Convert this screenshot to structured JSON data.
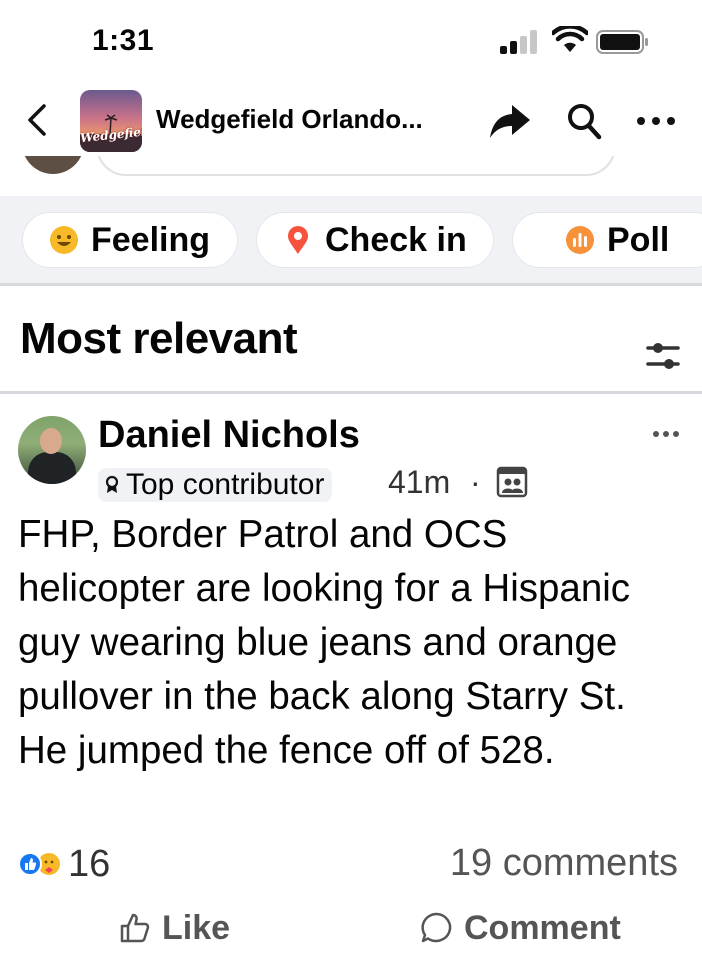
{
  "status_bar": {
    "time": "1:31"
  },
  "header": {
    "group_name": "Wedgefield Orlando...",
    "group_avatar_text": "Wedgefiel"
  },
  "composer_chips": [
    {
      "label": "Feeling",
      "icon": "feeling-icon",
      "color": "#f7b928"
    },
    {
      "label": "Check in",
      "icon": "location-pin-icon",
      "color": "#f5533d"
    },
    {
      "label": "Poll",
      "icon": "poll-icon",
      "color": "#f7923b"
    }
  ],
  "sort": {
    "title": "Most relevant",
    "icon": "filter-sliders-icon"
  },
  "post": {
    "author": "Daniel Nichols",
    "badge": "Top contributor",
    "time": "41m",
    "separator": "·",
    "audience_icon": "group-audience-icon",
    "text": "FHP, Border Patrol and OCS helicopter are looking for a Hispanic guy wearing blue jeans and orange pullover in the back along Starry St. He jumped the fence off of 528.",
    "reaction_count": "16",
    "comments": "19 comments",
    "actions": {
      "like": "Like",
      "comment": "Comment"
    }
  },
  "colors": {
    "accent": "#1877f2",
    "background": "#ffffff",
    "chip_row_bg": "#f0f2f5"
  }
}
